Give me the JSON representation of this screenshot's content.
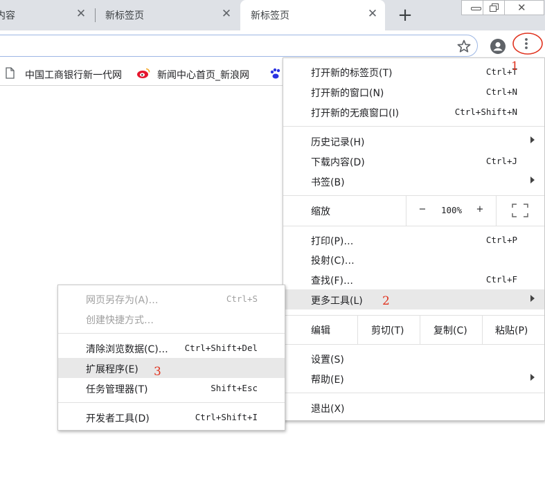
{
  "tabs": [
    {
      "title": "内容",
      "close": "✕"
    },
    {
      "title": "新标签页",
      "close": "✕"
    },
    {
      "title": "新标签页",
      "close": "✕",
      "active": true
    }
  ],
  "new_tab_label": "+",
  "bookmarks": [
    {
      "label": "中国工商银行新一代网",
      "icon": "page-icon"
    },
    {
      "label": "新闻中心首页_新浪网",
      "icon": "weibo-icon"
    }
  ],
  "main_menu": {
    "new_tab": {
      "label": "打开新的标签页(T)",
      "shortcut": "Ctrl+T"
    },
    "new_window": {
      "label": "打开新的窗口(N)",
      "shortcut": "Ctrl+N"
    },
    "incognito": {
      "label": "打开新的无痕窗口(I)",
      "shortcut": "Ctrl+Shift+N"
    },
    "history": {
      "label": "历史记录(H)"
    },
    "downloads": {
      "label": "下载内容(D)",
      "shortcut": "Ctrl+J"
    },
    "bookmarks": {
      "label": "书签(B)"
    },
    "zoom": {
      "label": "缩放",
      "minus": "−",
      "value": "100%",
      "plus": "+"
    },
    "print": {
      "label": "打印(P)…",
      "shortcut": "Ctrl+P"
    },
    "cast": {
      "label": "投射(C)…"
    },
    "find": {
      "label": "查找(F)…",
      "shortcut": "Ctrl+F"
    },
    "more_tools": {
      "label": "更多工具(L)"
    },
    "edit": {
      "label": "编辑",
      "cut": "剪切(T)",
      "copy": "复制(C)",
      "paste": "粘贴(P)"
    },
    "settings": {
      "label": "设置(S)"
    },
    "help": {
      "label": "帮助(E)"
    },
    "exit": {
      "label": "退出(X)"
    }
  },
  "submenu": {
    "save_as": {
      "label": "网页另存为(A)…",
      "shortcut": "Ctrl+S"
    },
    "create_shortcut": {
      "label": "创建快捷方式…"
    },
    "clear_data": {
      "label": "清除浏览数据(C)…",
      "shortcut": "Ctrl+Shift+Del"
    },
    "extensions": {
      "label": "扩展程序(E)"
    },
    "task_manager": {
      "label": "任务管理器(T)",
      "shortcut": "Shift+Esc"
    },
    "dev_tools": {
      "label": "开发者工具(D)",
      "shortcut": "Ctrl+Shift+I"
    }
  },
  "annotations": {
    "step1": "1",
    "step2": "2",
    "step3": "3"
  },
  "colors": {
    "annotation": "#e0321e",
    "highlight": "#e8e8e8",
    "tabstrip": "#dee1e6"
  }
}
